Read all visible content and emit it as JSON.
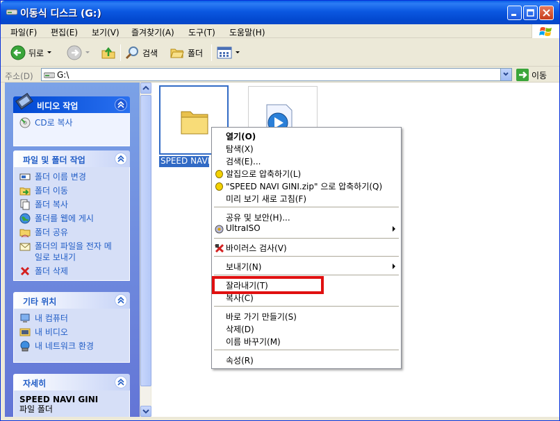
{
  "window": {
    "title": "이동식 디스크 (G:)"
  },
  "menubar": {
    "items": [
      "파일(F)",
      "편집(E)",
      "보기(V)",
      "즐겨찾기(A)",
      "도구(T)",
      "도움말(H)"
    ]
  },
  "toolbar": {
    "back_label": "뒤로",
    "search_label": "검색",
    "folders_label": "폴더"
  },
  "address": {
    "label": "주소(D)",
    "value": "G:\\",
    "go_label": "이동"
  },
  "taskpane": {
    "video_tasks": {
      "title": "비디오 작업",
      "items": [
        "CD로 복사"
      ]
    },
    "file_folder_tasks": {
      "title": "파일 및 폴더 작업",
      "items": [
        "폴더 이름 변경",
        "폴더 이동",
        "폴더 복사",
        "폴더를 웹에 게시",
        "폴더 공유",
        "폴더의 파일을 전자 메일로 보내기",
        "폴더 삭제"
      ]
    },
    "other_places": {
      "title": "기타 위치",
      "items": [
        "내 컴퓨터",
        "내 비디오",
        "내 네트워크 환경"
      ]
    },
    "details": {
      "title": "자세히",
      "name": "SPEED NAVI GINI",
      "type": "파일 폴더"
    }
  },
  "files": [
    {
      "label": "SPEED NAVI GINI",
      "selected": true,
      "icon": "folder-icon"
    },
    {
      "label": "",
      "selected": false,
      "icon": "media-file-icon"
    }
  ],
  "context_menu": {
    "items": [
      {
        "label": "열기(O)",
        "bold": true
      },
      {
        "label": "탐색(X)"
      },
      {
        "label": "검색(E)..."
      },
      {
        "label": "알집으로 압축하기(L)",
        "icon": "alzip-icon"
      },
      {
        "label": "\"SPEED NAVI GINI.zip\" 으로 압축하기(Q)",
        "icon": "alzip-icon"
      },
      {
        "label": "미리 보기 새로 고침(F)"
      },
      {
        "label": "공유 및 보안(H)..."
      },
      {
        "label": "UltraISO",
        "icon": "ultraiso-icon",
        "submenu": true
      },
      {
        "label": "바이러스 검사(V)",
        "icon": "virus-scan-icon"
      },
      {
        "label": "보내기(N)",
        "submenu": true
      },
      {
        "label": "잘라내기(T)",
        "highlighted": true
      },
      {
        "label": "복사(C)"
      },
      {
        "label": "바로 가기 만들기(S)"
      },
      {
        "label": "삭제(D)"
      },
      {
        "label": "이름 바꾸기(M)"
      },
      {
        "label": "속성(R)"
      }
    ]
  },
  "colors": {
    "titlebar": "#0a5fe6",
    "selection": "#316ac5",
    "highlight": "#e01010",
    "task_link": "#215dc6"
  }
}
